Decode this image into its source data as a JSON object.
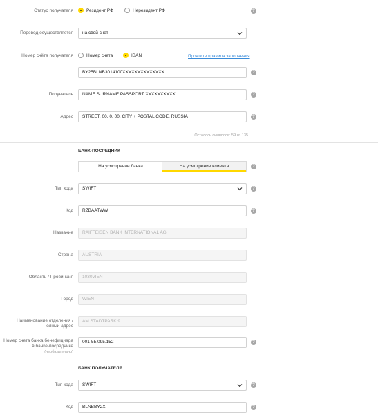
{
  "recipient_status": {
    "label": "Статус получателя",
    "options": [
      "Резидент РФ",
      "Нерезидент РФ"
    ],
    "selected": "Резидент РФ"
  },
  "transfer": {
    "label": "Перевод осуществляется",
    "value": "на свой счет"
  },
  "account_number": {
    "label": "Номер счёта получателя",
    "options": [
      "Номер счета",
      "IBAN"
    ],
    "selected": "IBAN",
    "rules_link": "Прочтите правила заполнения",
    "value": "BY25BLNB3014100XXXXXXXXXXXXXX"
  },
  "recipient": {
    "label": "Получатель",
    "value": "NAME SURNAME PASSPORT XXXXXXXXXX"
  },
  "address": {
    "label": "Адрес",
    "value": "STREET, 00, 0, 00, CITY + POSTAL CODE, RUSSIA",
    "counter": "Осталось символов: 59 из 135"
  },
  "intermediary": {
    "title": "БАНК-ПОСРЕДНИК",
    "tabs": [
      "На усмотрение банка",
      "На усмотрение клиента"
    ],
    "active_tab": "На усмотрение клиента",
    "code_type": {
      "label": "Тип кода",
      "value": "SWIFT"
    },
    "code": {
      "label": "Код",
      "value": "RZBAATWW"
    },
    "name": {
      "label": "Название",
      "value": "RAIFFEISEN BANK INTERNATIONAL AG"
    },
    "country": {
      "label": "Страна",
      "value": "AUSTRIA"
    },
    "region": {
      "label": "Область / Провинция",
      "value": "1030VIEN"
    },
    "city": {
      "label": "Город",
      "value": "WIEN"
    },
    "branch": {
      "label_line1": "Наименование отделения /",
      "label_line2": "Полный адрес",
      "value": "AM STADTPARK 9"
    },
    "beneficiary_account": {
      "label_line1": "Номер счета банка бенефициара",
      "label_line2": "в банке-посреднике",
      "label_note": "(необязательно)",
      "value": "001-55.095.152"
    }
  },
  "recipient_bank": {
    "title": "БАНК ПОЛУЧАТЕЛЯ",
    "code_type": {
      "label": "Тип кода",
      "value": "SWIFT"
    },
    "code": {
      "label": "Код",
      "value": "BLNBBY2X"
    }
  },
  "help_glyph": "?",
  "colors": {
    "accent": "#ffd800",
    "link": "#3a8bd8"
  }
}
